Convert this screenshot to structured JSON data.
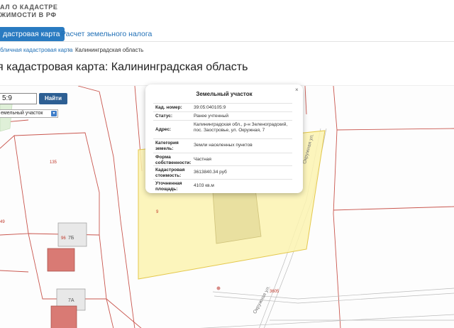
{
  "brand": {
    "line1": "АЛ О КАДАСТРЕ",
    "line2": "ЖИМОСТИ В РФ"
  },
  "nav": {
    "items": [
      {
        "label": "дастровая карта",
        "active": true
      },
      {
        "label": "Расчет земельного налога",
        "active": false
      }
    ]
  },
  "breadcrumb": {
    "link": "убличная кадастровая карта",
    "separator": "›",
    "current": "Калининградская область"
  },
  "page_title": "я кадастровая карта: Калининградская область",
  "search": {
    "value": "5:9",
    "button_label": "Найти",
    "object_type": "емельный участок"
  },
  "popup": {
    "title": "Земельный участок",
    "close_label": "×",
    "rows": [
      {
        "key": "Кад. номер:",
        "value": "39:05:040105:9"
      },
      {
        "key": "Статус:",
        "value": "Ранее учтенный"
      },
      {
        "key": "Адрес:",
        "value": "Калининградская обл., р-н Зеленоградский, пос. Заостровье, ул. Окружная, 7"
      },
      {
        "key": "Категория земель:",
        "value": "Земли населенных пунктов"
      },
      {
        "key": "Форма собственности:",
        "value": "Частная"
      },
      {
        "key": "Кадастровая стоимость:",
        "value": "3613840.34 руб"
      },
      {
        "key": "Уточненная площадь:",
        "value": "4103 кв.м"
      }
    ]
  },
  "map_labels": {
    "lot_135": "135",
    "lot_9": "9",
    "lot_96": "96",
    "lot_7b": "7Б",
    "lot_7a": "7А",
    "lot_3605": "3605",
    "street_1": "Окружная ул.",
    "street_2": "Окружная ул.",
    "edge_49": "49"
  },
  "colors": {
    "accent": "#2a7bc1",
    "parcel_fill": "#fbf3b0",
    "parcel_stroke": "#e4c84c",
    "building": "#d97a74",
    "boundary": "#c9564e"
  }
}
